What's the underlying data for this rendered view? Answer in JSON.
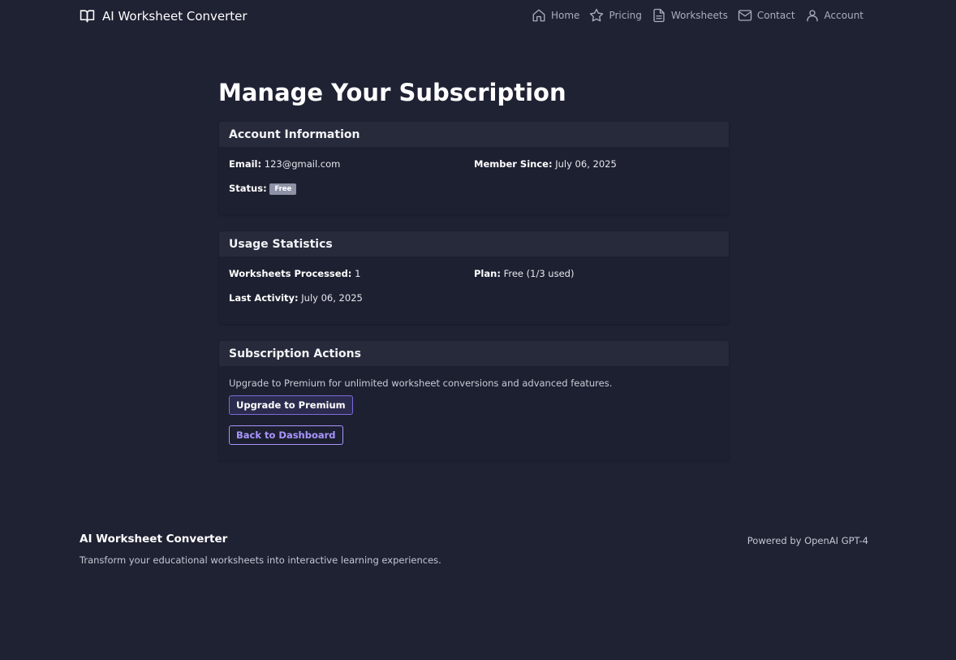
{
  "nav": {
    "brand": "AI Worksheet Converter",
    "brand_icon": "book-open-icon",
    "links": [
      {
        "label": "Home",
        "icon": "home-icon"
      },
      {
        "label": "Pricing",
        "icon": "star-icon"
      },
      {
        "label": "Worksheets",
        "icon": "document-icon"
      },
      {
        "label": "Contact",
        "icon": "mail-icon"
      },
      {
        "label": "Account",
        "icon": "user-icon"
      }
    ]
  },
  "page": {
    "title": "Manage Your Subscription"
  },
  "account": {
    "header": "Account Information",
    "email_label": "Email:",
    "email_value": "123@gmail.com",
    "member_since_label": "Member Since:",
    "member_since_value": "July 06, 2025",
    "status_label": "Status:",
    "status_badge": "Free"
  },
  "usage": {
    "header": "Usage Statistics",
    "processed_label": "Worksheets Processed:",
    "processed_value": "1",
    "plan_label": "Plan:",
    "plan_value": "Free (1/3 used)",
    "last_activity_label": "Last Activity:",
    "last_activity_value": "July 06, 2025"
  },
  "actions": {
    "header": "Subscription Actions",
    "description": "Upgrade to Premium for unlimited worksheet conversions and advanced features.",
    "upgrade_button": "Upgrade to Premium",
    "back_button": "Back to Dashboard"
  },
  "footer": {
    "title": "AI Worksheet Converter",
    "tagline": "Transform your educational worksheets into interactive learning experiences.",
    "powered": "Powered by OpenAI GPT-4"
  },
  "colors": {
    "background": "#1f2233",
    "card_header": "#272a3a",
    "accent": "#a995ff",
    "badge": "#8d92a6"
  }
}
